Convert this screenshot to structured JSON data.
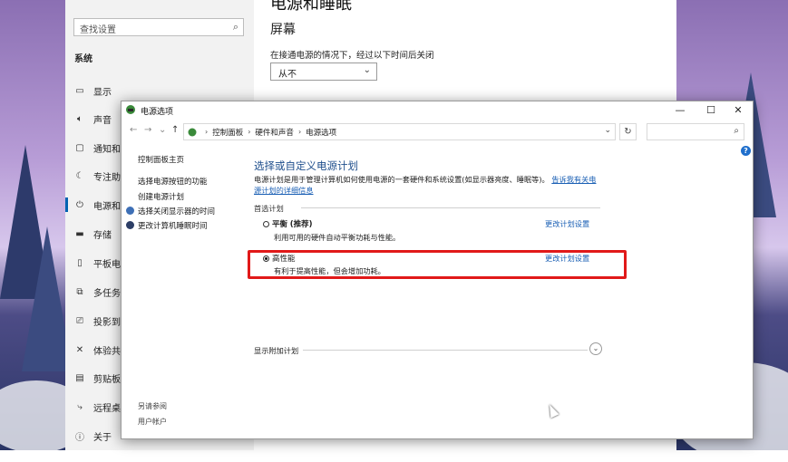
{
  "settings": {
    "search_placeholder": "查找设置",
    "section_label": "系统",
    "nav_items": [
      {
        "label": "显示",
        "icon": "display-icon"
      },
      {
        "label": "声音",
        "icon": "sound-icon"
      },
      {
        "label": "通知和",
        "icon": "notifications-icon"
      },
      {
        "label": "专注助",
        "icon": "focus-assist-icon"
      },
      {
        "label": "电源和",
        "icon": "power-icon"
      },
      {
        "label": "存储",
        "icon": "storage-icon"
      },
      {
        "label": "平板电",
        "icon": "tablet-icon"
      },
      {
        "label": "多任务",
        "icon": "multitasking-icon"
      },
      {
        "label": "投影到",
        "icon": "projecting-icon"
      },
      {
        "label": "体验共",
        "icon": "shared-experiences-icon"
      },
      {
        "label": "剪贴板",
        "icon": "clipboard-icon"
      },
      {
        "label": "远程桌",
        "icon": "remote-desktop-icon"
      },
      {
        "label": "关于",
        "icon": "info-icon"
      }
    ],
    "page_title": "电源和睡眠",
    "screen_title": "屏幕",
    "plugged_label": "在接通电源的情况下，经过以下时间后关闭",
    "select_value": "从不"
  },
  "power_window": {
    "title": "电源选项",
    "buttons": {
      "minimize": "—",
      "maximize": "☐",
      "close": "✕"
    },
    "breadcrumbs": [
      "控制面板",
      "硬件和声音",
      "电源选项"
    ],
    "left_links": [
      "控制面板主页",
      "选择电源按钮的功能",
      "创建电源计划",
      "选择关闭显示器的时间",
      "更改计算机睡眠时间"
    ],
    "see_also": [
      "另请参阅",
      "用户帐户"
    ],
    "heading": "选择或自定义电源计划",
    "description": "电源计划是用于管理计算机如何使用电源的一套硬件和系统设置(如显示器亮度、睡眠等)。",
    "description_link": "告诉我有关电源计划的详细信息",
    "group_label": "首选计划",
    "plans": [
      {
        "name": "平衡",
        "tag": "(推荐)",
        "desc": "利用可用的硬件自动平衡功耗与性能。",
        "selected": false,
        "change": "更改计划设置"
      },
      {
        "name": "高性能",
        "tag": "",
        "desc": "有利于提高性能，但会增加功耗。",
        "selected": true,
        "change": "更改计划设置"
      }
    ],
    "more_plans": "显示附加计划"
  }
}
